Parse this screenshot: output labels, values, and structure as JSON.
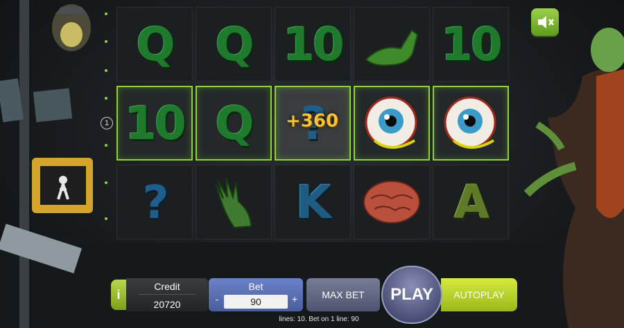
{
  "reels": [
    [
      "Q",
      "10",
      "?"
    ],
    [
      "Q",
      "Q",
      "hand"
    ],
    [
      "10",
      "?",
      "K"
    ],
    [
      "tongue",
      "eyeball",
      "brain"
    ],
    [
      "10",
      "eyeball",
      "A"
    ]
  ],
  "symbols": {
    "r0c0": "Q",
    "r0c1": "Q",
    "r0c2": "10",
    "r0c4": "10",
    "r1c0": "10",
    "r1c1": "Q",
    "r1c2": "?",
    "r2c0": "?",
    "r2c2": "K",
    "r2c4": "A"
  },
  "win_amount": "+360",
  "payline_marker": "1",
  "controls": {
    "info_label": "i",
    "credit_label": "Credit",
    "credit_value": "20720",
    "bet_label": "Bet",
    "bet_value": "90",
    "bet_minus": "-",
    "bet_plus": "+",
    "maxbet_label": "MAX BET",
    "play_label": "PLAY",
    "autoplay_label": "AUTOPLAY"
  },
  "status": {
    "lines_text": "lines: 10.   Bet on 1 line: 90"
  },
  "colors": {
    "accent_green": "#8fd33a",
    "win_gold": "#f5c23a",
    "bet_blue": "#5a6fb5"
  },
  "icons": {
    "mute": "speaker-muted-icon"
  }
}
